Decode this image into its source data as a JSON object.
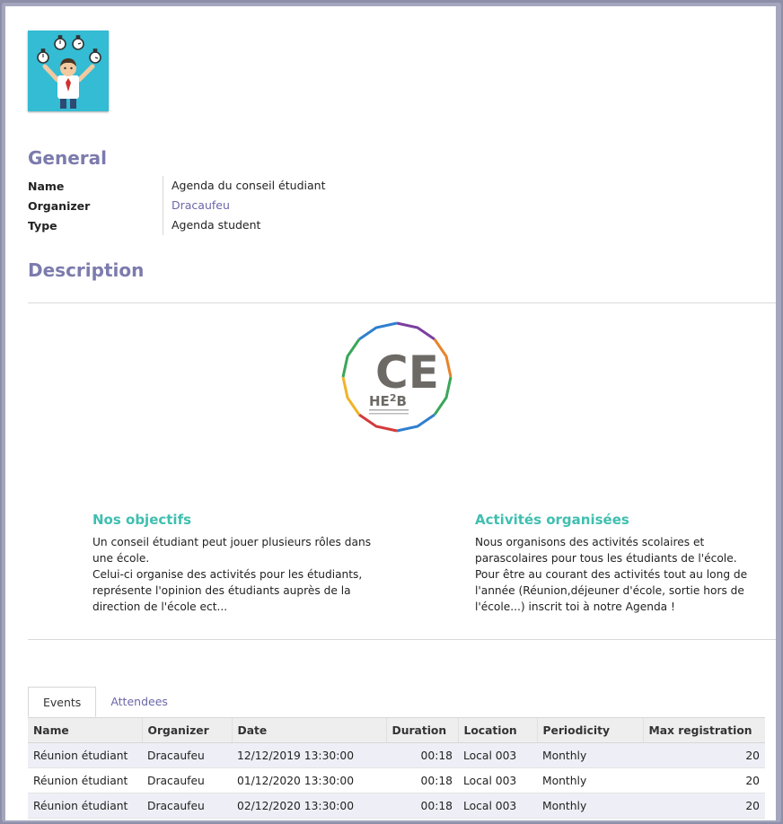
{
  "avatar_icon": "juggling-stopwatches-person-icon",
  "general": {
    "heading": "General",
    "fields": [
      {
        "label": "Name",
        "value": "Agenda du conseil étudiant"
      },
      {
        "label": "Organizer",
        "value": "Dracaufeu"
      },
      {
        "label": "Type",
        "value": "Agenda student"
      }
    ]
  },
  "description": {
    "heading": "Description",
    "logo": {
      "letters": "CE",
      "brand": "HE2B",
      "brand_main": "HE",
      "brand_sup": "2",
      "brand_tail": "B"
    },
    "columns": [
      {
        "title": "Nos objectifs",
        "lines": [
          "Un conseil étudiant peut jouer plusieurs rôles dans",
          "une école.",
          "Celui-ci organise des activités pour les étudiants,",
          "représente l'opinion des étudiants auprès de la",
          "direction de l'école ect..."
        ]
      },
      {
        "title": "Activités organisées",
        "lines": [
          "Nous organisons des activités scolaires et",
          "parascolaires pour tous les étudiants de l'école.",
          "Pour être au courant des activités tout au long de",
          "l'année (Réunion,déjeuner d'école, sortie hors de",
          "l'école...) inscrit toi à notre Agenda !"
        ]
      }
    ]
  },
  "tabs": [
    {
      "label": "Events",
      "active": true
    },
    {
      "label": "Attendees",
      "active": false
    }
  ],
  "events_table": {
    "columns": [
      "Name",
      "Organizer",
      "Date",
      "Duration",
      "Location",
      "Periodicity",
      "Max registration"
    ],
    "rows": [
      [
        "Réunion étudiant",
        "Dracaufeu",
        "12/12/2019 13:30:00",
        "00:18",
        "Local 003",
        "Monthly",
        "20"
      ],
      [
        "Réunion étudiant",
        "Dracaufeu",
        "01/12/2020 13:30:00",
        "00:18",
        "Local 003",
        "Monthly",
        "20"
      ],
      [
        "Réunion étudiant",
        "Dracaufeu",
        "02/12/2020 13:30:00",
        "00:18",
        "Local 003",
        "Monthly",
        "20"
      ]
    ]
  },
  "colors": {
    "heading": "#7c7bad",
    "link": "#6a67a8",
    "accent_teal": "#3fbfb0",
    "avatar_bg": "#33bcd3"
  }
}
